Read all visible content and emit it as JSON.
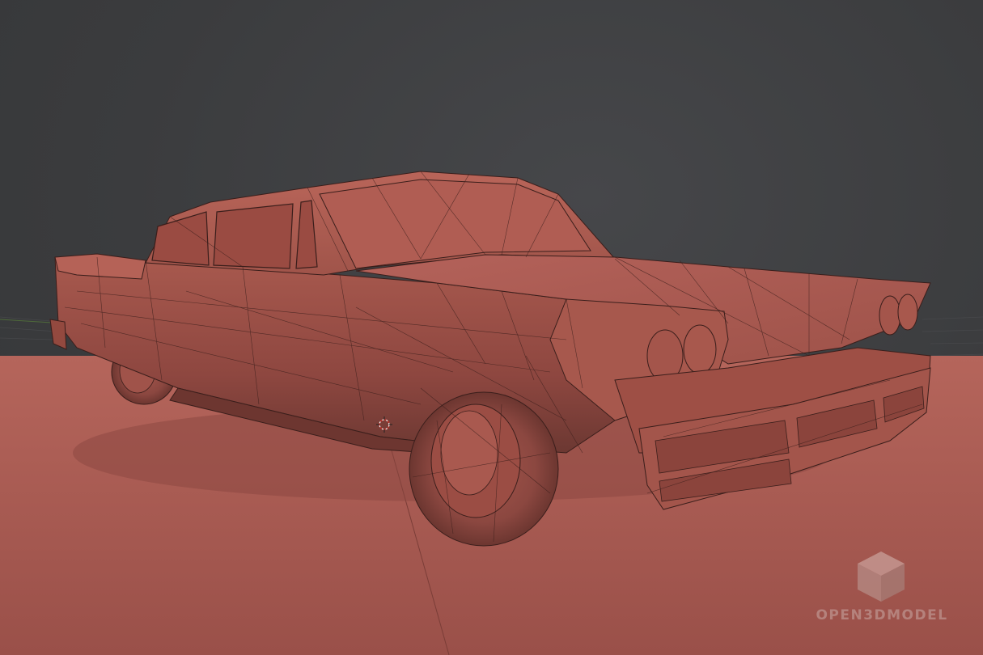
{
  "watermark": {
    "text": "OPEN3DMODEL",
    "icon": "cube-logo-icon"
  },
  "colors": {
    "background": "#3d3e40",
    "ground": "#b9655b",
    "model_base": "#a5554b",
    "model_light": "#c06a5e",
    "model_shadow": "#5a2f2a",
    "wireframe": "#3a1e1b"
  }
}
